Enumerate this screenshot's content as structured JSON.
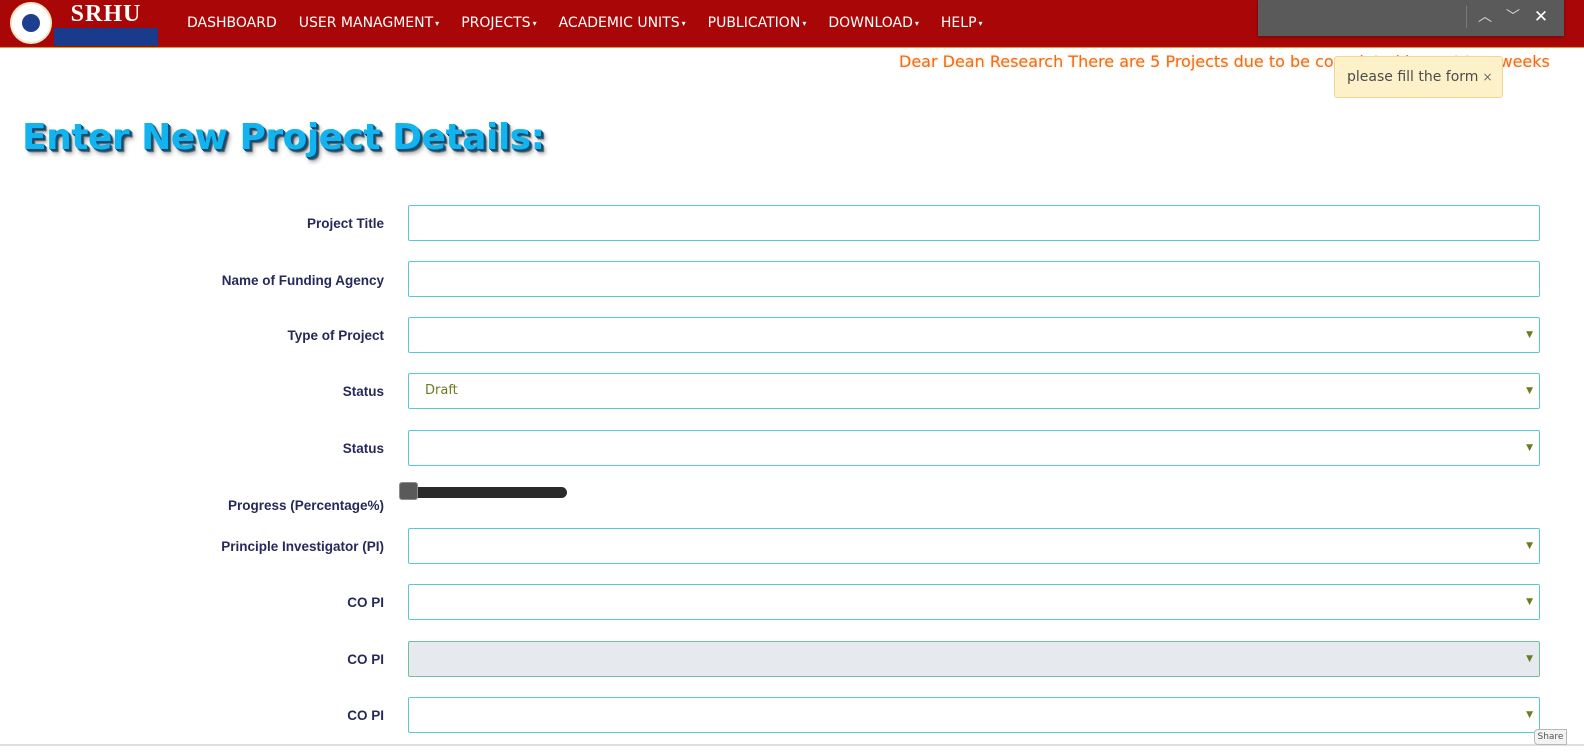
{
  "header": {
    "logo_text": "SRHU",
    "nav": [
      {
        "label": "DASHBOARD",
        "dropdown": false
      },
      {
        "label": "USER MANAGMENT",
        "dropdown": true
      },
      {
        "label": "PROJECTS",
        "dropdown": true
      },
      {
        "label": "ACADEMIC UNITS",
        "dropdown": true
      },
      {
        "label": "PUBLICATION",
        "dropdown": true
      },
      {
        "label": "DOWNLOAD",
        "dropdown": true
      },
      {
        "label": "HELP",
        "dropdown": true
      }
    ],
    "caret": "▾"
  },
  "findbar": {
    "prev": "︿",
    "next": "﹀",
    "close": "✕"
  },
  "marquee": "Dear Dean Research There are 5 Projects due to be completed in next two weeks",
  "toast": {
    "text": "please fill the form",
    "close": "×"
  },
  "page_title": "Enter New Project Details:",
  "form": {
    "project_title_label": "Project Title",
    "funding_agency_label": "Name of Funding Agency",
    "type_label": "Type of Project",
    "status_label": "Status",
    "status_value": "Draft",
    "status2_label": "Status",
    "progress_label": "Progress (Percentage%)",
    "progress_value": 0,
    "pi_label": "Principle Investigator (PI)",
    "copi1_label": "CO PI",
    "copi2_label": "CO PI",
    "copi3_label": "CO PI",
    "select_arrow": "▼"
  },
  "share_label": "Share",
  "colors": {
    "navbar": "#a90707",
    "title": "#12b4ef",
    "field_border": "#5ac7d8",
    "marquee": "#f26a1b"
  }
}
